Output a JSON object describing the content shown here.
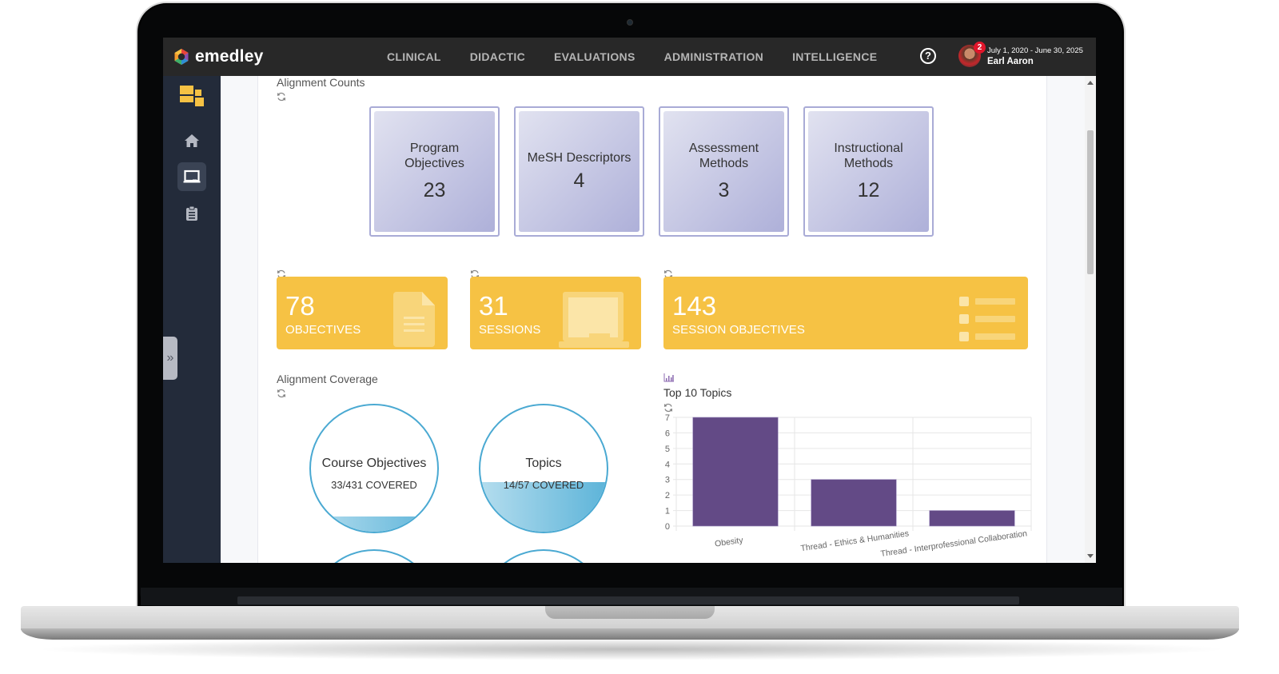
{
  "app": {
    "brand": "emedley",
    "nav": [
      "CLINICAL",
      "DIDACTIC",
      "EVALUATIONS",
      "ADMINISTRATION",
      "INTELLIGENCE"
    ],
    "help_icon": "?",
    "user": {
      "notifications": "2",
      "date_range": "July 1, 2020 - June 30, 2025",
      "name": "Earl Aaron"
    }
  },
  "sidebar": {
    "items": [
      {
        "icon": "dashboard-icon"
      },
      {
        "icon": "home-icon"
      },
      {
        "icon": "chalkboard-icon",
        "active": true
      },
      {
        "icon": "clipboard-icon"
      }
    ],
    "expander_icon": "»"
  },
  "alignment_counts": {
    "title": "Alignment Counts",
    "cards": [
      {
        "label": "Program Objectives",
        "value": "23"
      },
      {
        "label": "MeSH Descriptors",
        "value": "4"
      },
      {
        "label": "Assessment Methods",
        "value": "3"
      },
      {
        "label": "Instructional Methods",
        "value": "12"
      }
    ]
  },
  "stats": [
    {
      "value": "78",
      "label": "OBJECTIVES",
      "icon": "document-icon"
    },
    {
      "value": "31",
      "label": "SESSIONS",
      "icon": "chalkboard-icon"
    },
    {
      "value": "143",
      "label": "SESSION OBJECTIVES",
      "icon": "list-icon"
    }
  ],
  "alignment_coverage": {
    "title": "Alignment Coverage",
    "items": [
      {
        "title": "Course Objectives",
        "covered": "33/431 COVERED",
        "fraction": 0.0766
      },
      {
        "title": "Topics",
        "covered": "14/57 COVERED",
        "fraction": 0.2456
      }
    ]
  },
  "colors": {
    "accent_yellow": "#f6c244",
    "bar_purple": "#634a86",
    "coverage_blue": "#4aa9d2",
    "topbar": "#282828",
    "sidebar": "#232b3a"
  },
  "chart_data": {
    "type": "bar",
    "title": "Top 10 Topics",
    "categories": [
      "Obesity",
      "Thread - Ethics & Humanities",
      "Thread - Interprofessional Collaboration"
    ],
    "values": [
      7,
      3,
      1
    ],
    "ylim": [
      0,
      7
    ],
    "yticks": [
      0,
      1,
      2,
      3,
      4,
      5,
      6,
      7
    ],
    "xlabel": "",
    "ylabel": "",
    "grid": true,
    "legend": "none"
  }
}
